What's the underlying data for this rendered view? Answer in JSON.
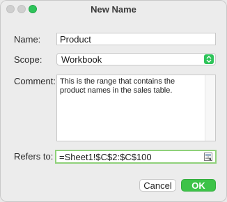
{
  "window": {
    "title": "New Name"
  },
  "form": {
    "name_label": "Name:",
    "name_value": "Product",
    "scope_label": "Scope:",
    "scope_value": "Workbook",
    "comment_label": "Comment:",
    "comment_value": "This is the range that contains the product names in the sales table.",
    "refers_label": "Refers to:",
    "refers_value": "=Sheet1!$C$2:$C$100"
  },
  "buttons": {
    "cancel_label": "Cancel",
    "ok_label": "OK"
  },
  "icons": {
    "close": "close-icon",
    "minimize": "minimize-icon",
    "zoom": "zoom-icon",
    "select_arrows": "chevron-updown-icon",
    "range_picker": "range-select-icon"
  },
  "colors": {
    "accent": "#2ec45a",
    "ok_button": "#3dc348",
    "focus_ring": "#8fd17a"
  }
}
